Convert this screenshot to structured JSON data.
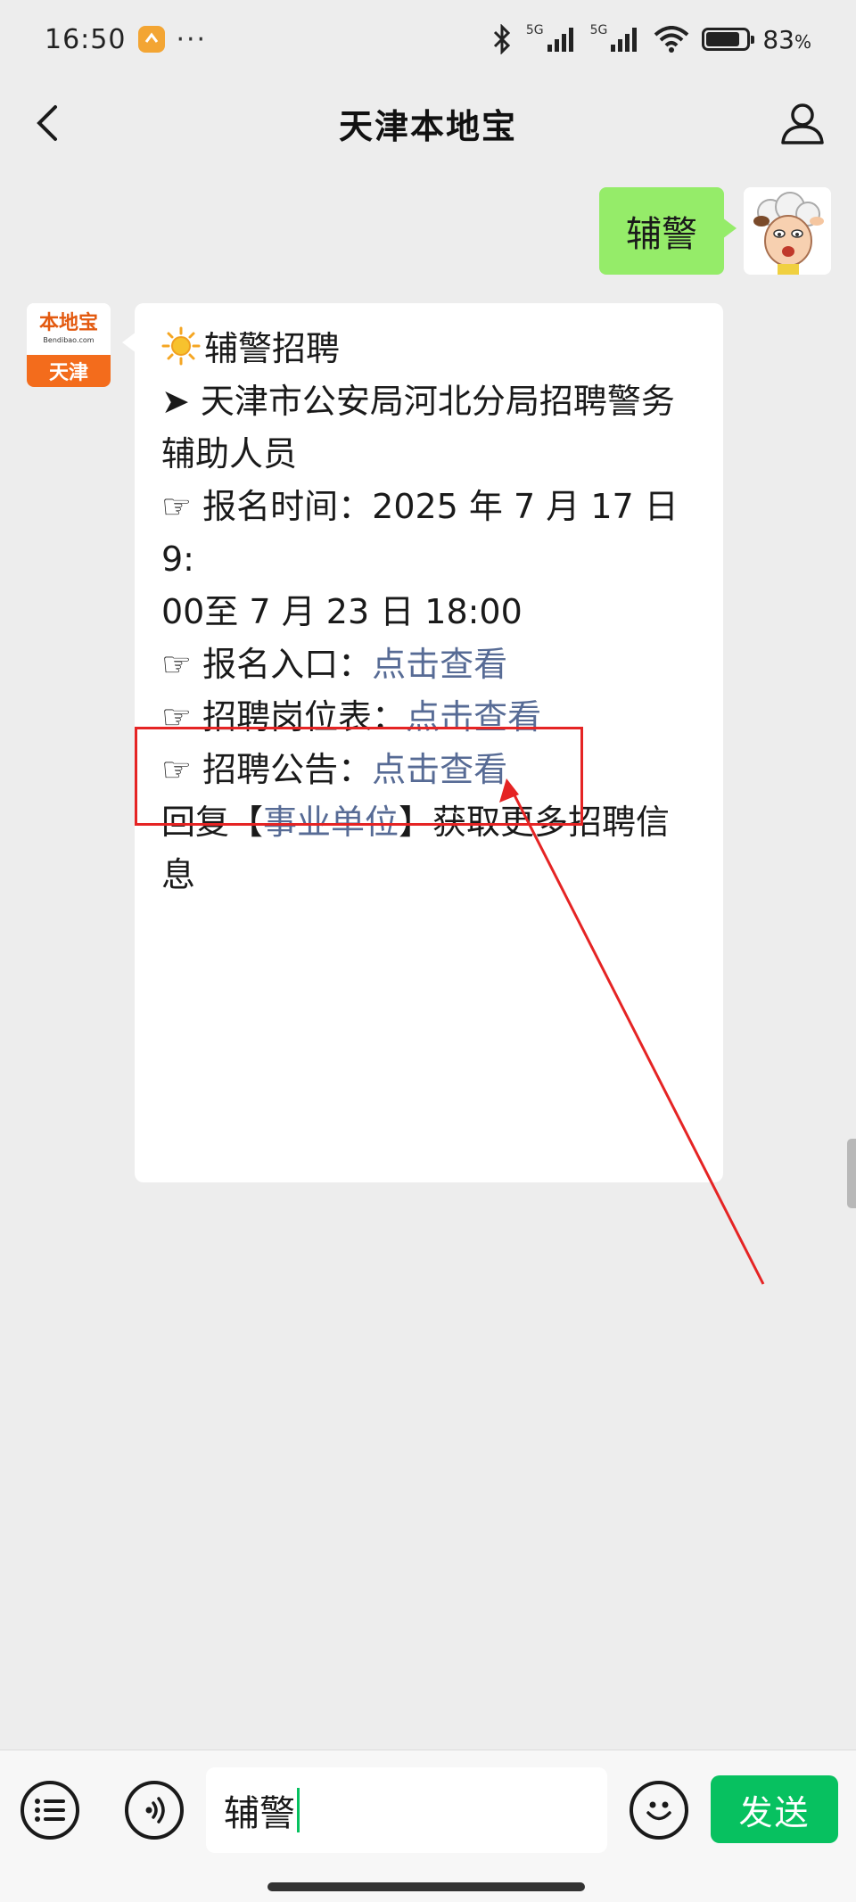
{
  "status_bar": {
    "time": "16:50",
    "network": "5G",
    "network_2": "5G",
    "battery_percent": "83",
    "battery_unit": "%",
    "more": "···"
  },
  "nav": {
    "title": "天津本地宝"
  },
  "messages": {
    "sent_text": "辅警",
    "bot_avatar_top": "本地宝",
    "bot_avatar_domain": "Bendibao.com",
    "bot_avatar_city": "天津",
    "header": "辅警招聘",
    "item1_prefix": "➤ 天津市公安局河北分局招聘警务",
    "item1_cont": "辅助人员",
    "time_line1": "☞ 报名时间：2025 年 7 月 17 日 9:",
    "time_line2": "00至 7 月 23 日 18:00",
    "entry_label": "☞ 报名入口：",
    "entry_link": "点击查看",
    "positions_label": "☞ 招聘岗位表：",
    "positions_link": "点击查看",
    "notice_label": "☞ 招聘公告：",
    "notice_link": "点击查看",
    "reply_prefix": "回复【",
    "reply_link": "事业单位",
    "reply_suffix": "】获取更多招聘信",
    "reply_cont": "息"
  },
  "input": {
    "value": "辅警",
    "send_label": "发送"
  },
  "colors": {
    "sent_bubble": "#95ec69",
    "link": "#576b95",
    "send_button": "#07c160",
    "annotation": "#e52424"
  }
}
